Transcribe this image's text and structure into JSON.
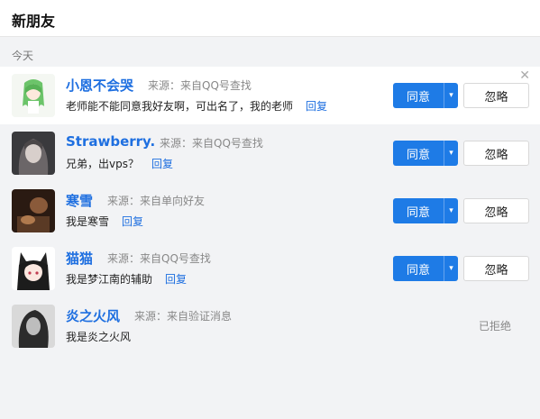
{
  "header": {
    "title": "新朋友"
  },
  "section": {
    "today": "今天"
  },
  "actions": {
    "agree": "同意",
    "ignore": "忽略",
    "reply": "回复",
    "dropdown": "▾",
    "close": "✕"
  },
  "requests": [
    {
      "name": "小恩不会哭",
      "source": "来源：来自QQ号查找",
      "message": "老师能不能同意我好友啊，可出名了，我的老师"
    },
    {
      "name": "Strawberry.",
      "source": "来源：来自QQ号查找",
      "message": "兄弟，出vps？"
    },
    {
      "name": "寒雪",
      "source": "来源：来自单向好友",
      "message": "我是寒雪"
    },
    {
      "name": "猫猫",
      "source": "来源：来自QQ号查找",
      "message": "我是梦江南的辅助"
    },
    {
      "name": "炎之火风",
      "source": "来源：来自验证消息",
      "message": "我是炎之火风",
      "status": "已拒绝"
    }
  ]
}
